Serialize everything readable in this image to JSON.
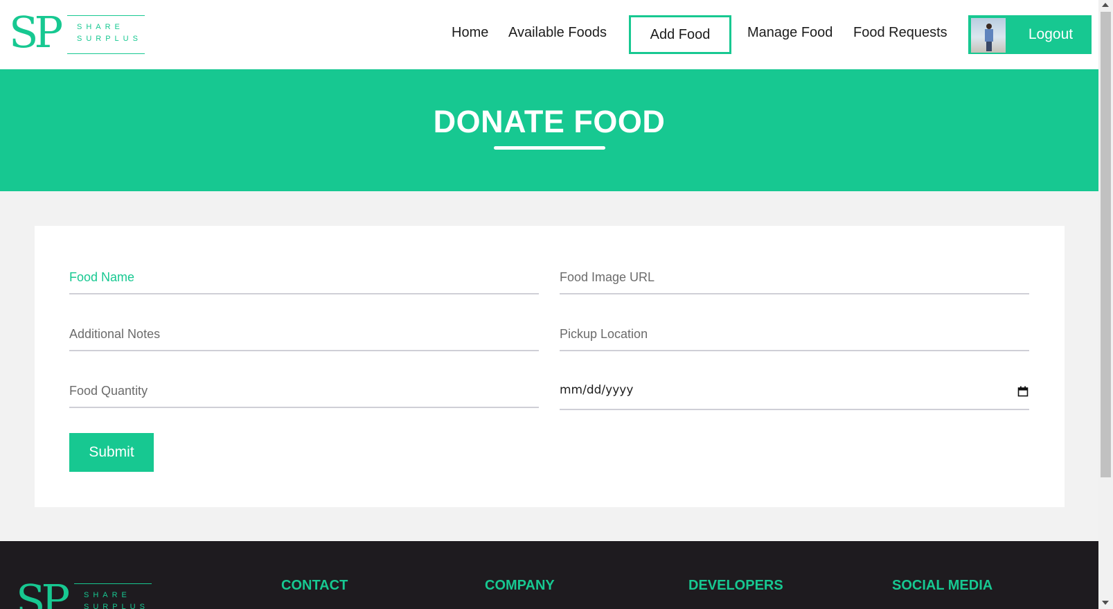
{
  "brand": {
    "initials": "SP",
    "word1": "SHARE",
    "word2": "SURPLUS",
    "color": "#17c891"
  },
  "nav": {
    "home": "Home",
    "available_foods": "Available Foods",
    "add_food": "Add Food",
    "manage_food": "Manage Food",
    "food_requests": "Food Requests",
    "logout": "Logout"
  },
  "banner": {
    "title": "DONATE FOOD",
    "background": "#17c891"
  },
  "form": {
    "food_name": {
      "placeholder": "Food Name",
      "value": ""
    },
    "food_image_url": {
      "placeholder": "Food Image URL",
      "value": ""
    },
    "additional_notes": {
      "placeholder": "Additional Notes",
      "value": ""
    },
    "pickup_location": {
      "placeholder": "Pickup Location",
      "value": ""
    },
    "food_quantity": {
      "placeholder": "Food Quantity",
      "value": ""
    },
    "expire_date": {
      "display": "mm/dd/yyyy",
      "icon": "calendar-icon"
    },
    "submit_label": "Submit"
  },
  "footer": {
    "contact": "CONTACT",
    "company": "COMPANY",
    "developers": "DEVELOPERS",
    "social_media": "SOCIAL MEDIA",
    "background": "#1e1b1f"
  }
}
